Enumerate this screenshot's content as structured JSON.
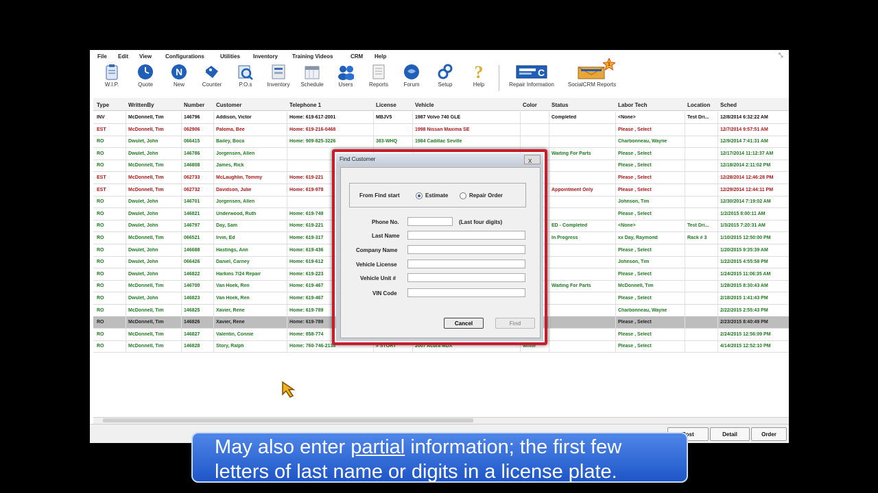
{
  "menu": [
    "File",
    "Edit",
    "View",
    "Configurations",
    "Utilities",
    "Inventory",
    "Training Videos",
    "CRM",
    "Help"
  ],
  "toolbar": [
    {
      "label": "W.I.P.",
      "icon": "clipboard-icon"
    },
    {
      "label": "Quote",
      "icon": "clock-icon"
    },
    {
      "label": "New",
      "icon": "new-icon"
    },
    {
      "label": "Counter",
      "icon": "tag-icon"
    },
    {
      "label": "P.O.s",
      "icon": "magnifier-icon"
    },
    {
      "label": "Inventory",
      "icon": "box-icon"
    },
    {
      "label": "Schedule",
      "icon": "calendar-icon"
    },
    {
      "label": "Users",
      "icon": "users-icon"
    },
    {
      "label": "Reports",
      "icon": "report-icon"
    },
    {
      "label": "Forum",
      "icon": "forum-icon"
    },
    {
      "label": "Setup",
      "icon": "gears-icon"
    },
    {
      "label": "Help",
      "icon": "question-icon"
    },
    {
      "label": "Repair Information",
      "icon": "repair-info-icon"
    },
    {
      "label": "SocialCRM Reports",
      "icon": "envelope-star-icon",
      "badge": "1"
    }
  ],
  "columns": [
    "Type",
    "WrittenBy",
    "Number",
    "Customer",
    "Telephone 1",
    "License",
    "Vehicle",
    "Color",
    "Status",
    "Labor Tech",
    "Location",
    "Sched"
  ],
  "rows": [
    {
      "style": "black",
      "cells": [
        "INV",
        "McDonnell, Tim",
        "146796",
        "Addison, Victor",
        "Home: 619-617-2001",
        "MBJV5",
        "1987 Volvo 740 GLE",
        "",
        "Completed",
        "<None>",
        "Test Dri...",
        "12/8/2014 6:32:22 AM"
      ]
    },
    {
      "style": "red",
      "cells": [
        "EST",
        "McDonnell, Tim",
        "062906",
        "Paloma, Bee",
        "Home: 619-216-0468",
        "",
        "1998 Nissan Maxima SE",
        "",
        "",
        "Please , Select",
        "",
        "12/7/2014 9:57:51 AM"
      ]
    },
    {
      "style": "green",
      "cells": [
        "RO",
        "Dwulet, John",
        "066415",
        "Bailey, Boca",
        "Home: 909-825-3226",
        "383-WHQ",
        "1984 Cadillac Seville",
        "",
        "",
        "Charbonneau, Wayne",
        "",
        "12/9/2014 7:41:31 AM"
      ]
    },
    {
      "style": "green",
      "cells": [
        "RO",
        "Dwulet, John",
        "146786",
        "Jorgensen, Allen",
        "",
        "",
        "",
        "",
        "Waiting For Parts",
        "Please , Select",
        "",
        "12/17/2014 11:12:37 AM"
      ]
    },
    {
      "style": "green",
      "cells": [
        "RO",
        "McDonnell, Tim",
        "146808",
        "James, Rick",
        "",
        "",
        "",
        "",
        "",
        "Please , Select",
        "",
        "12/18/2014 2:11:02 PM"
      ]
    },
    {
      "style": "red",
      "cells": [
        "EST",
        "McDonnell, Tim",
        "062733",
        "McLaughlin, Tommy",
        "Home: 619-221",
        "",
        "",
        "",
        "",
        "Please , Select",
        "",
        "12/28/2014 12:46:28 PM"
      ]
    },
    {
      "style": "red",
      "cells": [
        "EST",
        "McDonnell, Tim",
        "062732",
        "Davidson, Julie",
        "Home: 619-978",
        "",
        "",
        "",
        "Appointment Only",
        "Please , Select",
        "",
        "12/29/2014 12:44:11 PM"
      ]
    },
    {
      "style": "green",
      "cells": [
        "RO",
        "Dwulet, John",
        "146701",
        "Jorgensen, Allen",
        "",
        "",
        "",
        "",
        "",
        "Johnson, Tim",
        "",
        "12/30/2014 7:19:02 AM"
      ]
    },
    {
      "style": "green",
      "cells": [
        "RO",
        "Dwulet, John",
        "146821",
        "Underwood, Ruth",
        "Home: 619-749",
        "",
        "",
        "",
        "",
        "Please , Select",
        "",
        "1/2/2015 8:00:11 AM"
      ]
    },
    {
      "style": "green",
      "cells": [
        "RO",
        "Dwulet, John",
        "146797",
        "Day, Sam",
        "Home: 619-221",
        "",
        "",
        "",
        "ED - Completed",
        "<None>",
        "Test Dri...",
        "1/3/2015 7:20:31 AM"
      ]
    },
    {
      "style": "green",
      "cells": [
        "RO",
        "McDonnell, Tim",
        "066521",
        "Irvin, Ed",
        "Home: 619-317",
        "",
        "",
        "",
        "In Progress",
        "xx Day, Raymond",
        "Rack # 3",
        "1/10/2015 12:50:00 PM"
      ]
    },
    {
      "style": "green",
      "cells": [
        "RO",
        "Dwulet, John",
        "146688",
        "Hastings, Ann",
        "Home: 619-436",
        "",
        "",
        "",
        "",
        "Please , Select",
        "",
        "1/20/2015 9:35:39 AM"
      ]
    },
    {
      "style": "green",
      "cells": [
        "RO",
        "Dwulet, John",
        "066426",
        "Daniel, Carney",
        "Home: 619-612",
        "",
        "",
        "",
        "",
        "Johnson, Tim",
        "",
        "1/22/2015 4:55:58 PM"
      ]
    },
    {
      "style": "green",
      "cells": [
        "RO",
        "Dwulet, John",
        "146822",
        "Harkins 7/24 Repair",
        "Home: 619-223",
        "",
        "",
        "",
        "",
        "Please , Select",
        "",
        "1/24/2015 11:06:35 AM"
      ]
    },
    {
      "style": "green",
      "cells": [
        "RO",
        "McDonnell, Tim",
        "146700",
        "Van Hoek, Ren",
        "Home: 619-467",
        "",
        "",
        "",
        "Waiting For Parts",
        "McDonnell, Tim",
        "",
        "1/28/2015 8:30:43 AM"
      ]
    },
    {
      "style": "green",
      "cells": [
        "RO",
        "Dwulet, John",
        "146823",
        "Van Hoek, Ren",
        "Home: 619-467",
        "",
        "",
        "",
        "",
        "Please , Select",
        "",
        "2/18/2015 1:41:43 PM"
      ]
    },
    {
      "style": "green",
      "cells": [
        "RO",
        "McDonnell, Tim",
        "146825",
        "Xavier, Rene",
        "Home: 619-789",
        "",
        "",
        "",
        "",
        "Charbonneau, Wayne",
        "",
        "2/22/2015 2:55:43 PM"
      ]
    },
    {
      "style": "sel",
      "cells": [
        "RO",
        "McDonnell, Tim",
        "146826",
        "Xavier, Rene",
        "Home: 619-789",
        "",
        "",
        "",
        "",
        "Please , Select",
        "",
        "2/23/2015 8:40:49 PM"
      ]
    },
    {
      "style": "green",
      "cells": [
        "RO",
        "McDonnell, Tim",
        "146827",
        "Valentin, Connie",
        "Home: 858-774",
        "",
        "",
        "",
        "",
        "Please , Select",
        "",
        "2/24/2015 12:56:09 PM"
      ]
    },
    {
      "style": "green",
      "cells": [
        "RO",
        "McDonnell, Tim",
        "146828",
        "Story, Ralph",
        "Home: 760-746-2138",
        "# STORY",
        "2007 Acura MDX",
        "White",
        "",
        "Please , Select",
        "",
        "4/14/2015 12:52:10 PM"
      ]
    }
  ],
  "bottom_buttons": [
    "Post",
    "Detail",
    "Order"
  ],
  "dialog": {
    "title": "Find Customer",
    "close": "X",
    "find_start_label": "From Find start",
    "option_estimate": "Estimate",
    "option_repair": "Repair Order",
    "fields": {
      "phone": "Phone No.",
      "phone_hint": "(Last four digits)",
      "last_name": "Last Name",
      "company": "Company Name",
      "vehicle_license": "Vehicle License",
      "vehicle_unit": "Vehicle Unit #",
      "vin": "VIN Code"
    },
    "cancel": "Cancel",
    "find": "Find"
  },
  "caption": {
    "pre": "May also enter ",
    "underlined": "partial",
    "post": " information; the first few",
    "line2": "letters of last name or digits in a license plate."
  }
}
